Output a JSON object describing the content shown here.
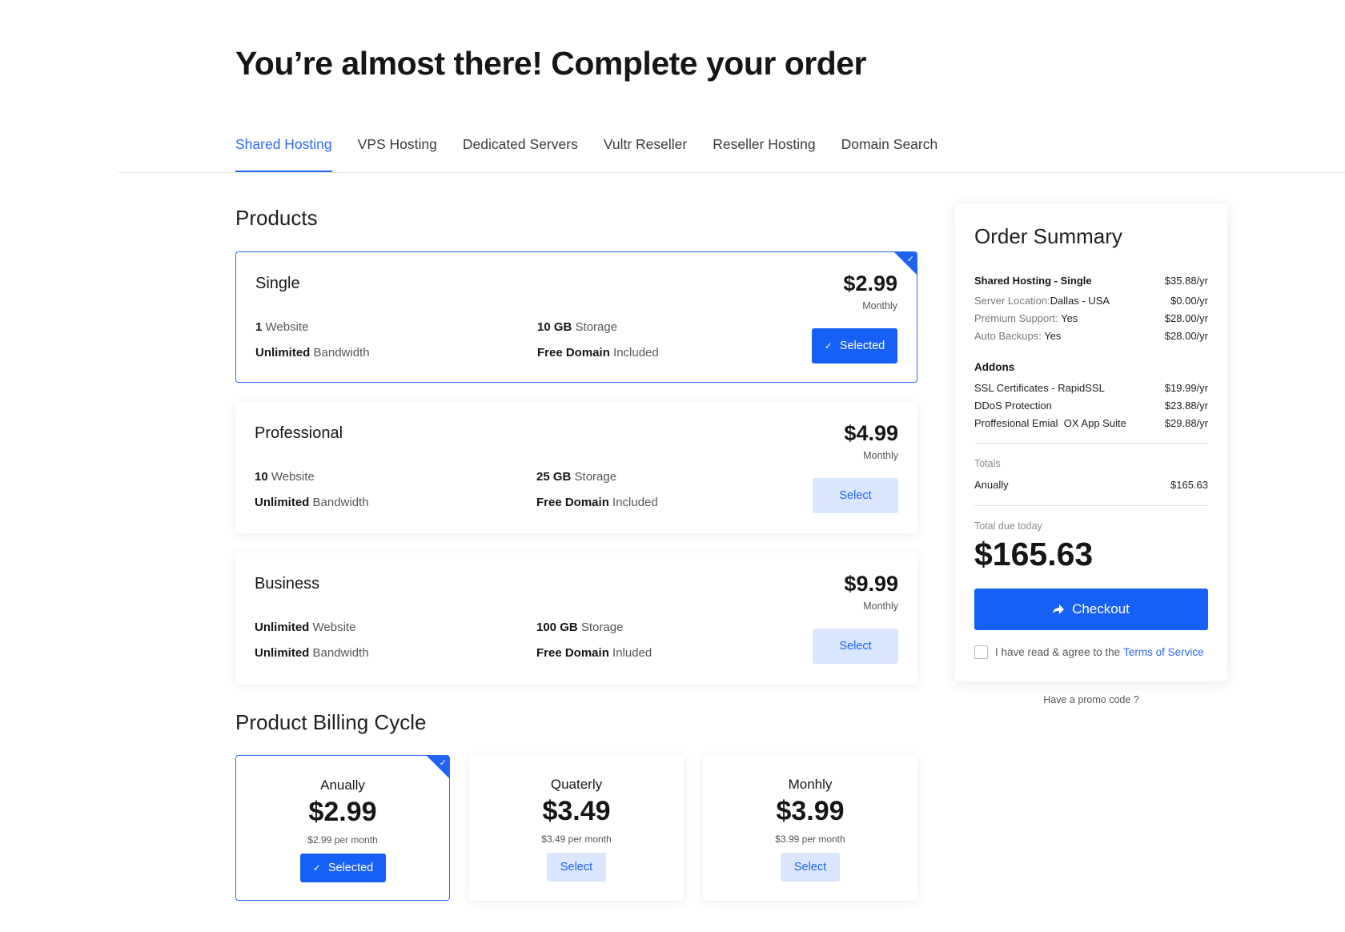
{
  "header": {
    "title": "You’re almost there! Complete your order"
  },
  "tabs": [
    {
      "label": "Shared Hosting",
      "active": true
    },
    {
      "label": "VPS Hosting",
      "active": false
    },
    {
      "label": "Dedicated Servers",
      "active": false
    },
    {
      "label": "Vultr Reseller",
      "active": false
    },
    {
      "label": "Reseller Hosting",
      "active": false
    },
    {
      "label": "Domain Search",
      "active": false
    }
  ],
  "products": {
    "title": "Products",
    "items": [
      {
        "name": "Single",
        "price": "$2.99",
        "period": "Monthly",
        "features": [
          {
            "bold": "1",
            "text": " Website"
          },
          {
            "bold": "10 GB",
            "text": " Storage"
          },
          {
            "bold": "Unlimited",
            "text": " Bandwidth"
          },
          {
            "bold": "Free Domain",
            "text": " Included"
          }
        ],
        "button": "Selected",
        "selected": true
      },
      {
        "name": "Professional",
        "price": "$4.99",
        "period": "Monthly",
        "features": [
          {
            "bold": "10",
            "text": " Website"
          },
          {
            "bold": "25 GB",
            "text": " Storage"
          },
          {
            "bold": "Unlimited",
            "text": " Bandwidth"
          },
          {
            "bold": "Free Domain",
            "text": " Included"
          }
        ],
        "button": "Select",
        "selected": false
      },
      {
        "name": "Business",
        "price": "$9.99",
        "period": "Monthly",
        "features": [
          {
            "bold": "Unlimited",
            "text": " Website"
          },
          {
            "bold": "100 GB",
            "text": " Storage"
          },
          {
            "bold": "Unlimited",
            "text": " Bandwidth"
          },
          {
            "bold": "Free Domain",
            "text": " Inluded"
          }
        ],
        "button": "Select",
        "selected": false
      }
    ]
  },
  "billing": {
    "title": "Product Billing Cycle",
    "items": [
      {
        "name": "Anually",
        "price": "$2.99",
        "per": "$2.99 per month",
        "button": "Selected",
        "selected": true
      },
      {
        "name": "Quaterly",
        "price": "$3.49",
        "per": "$3.49 per month",
        "button": "Select",
        "selected": false
      },
      {
        "name": "Monhly",
        "price": "$3.99",
        "per": "$3.99 per month",
        "button": "Select",
        "selected": false
      }
    ]
  },
  "summary": {
    "title": "Order Summary",
    "main_item": {
      "label": "Shared Hosting - Single",
      "value": "$35.88/yr"
    },
    "details": [
      {
        "label": "Server Location:",
        "detail": "Dallas - USA",
        "value": "$0.00/yr"
      },
      {
        "label": "Premium Support:",
        "detail": " Yes",
        "value": "$28.00/yr"
      },
      {
        "label": "Auto Backups:",
        "detail": " Yes",
        "value": "$28.00/yr"
      }
    ],
    "addons_title": "Addons",
    "addons": [
      {
        "label": "SSL Certificates - RapidSSL",
        "value": "$19.99/yr"
      },
      {
        "label": "DDoS Protection",
        "value": "$23.88/yr"
      },
      {
        "label": "Proffesional Emial  OX App Suite",
        "value": "$29.88/yr"
      }
    ],
    "totals_label": "Totals",
    "annually_label": "Anually",
    "annually_value": "$165.63",
    "due_label": "Total due today",
    "due_value": "$165.63",
    "checkout_label": "Checkout",
    "agree_text": "I have read & agree to the",
    "tos_link": "Terms of Service",
    "promo": "Have a promo code ?"
  },
  "colors": {
    "accent": "#1660f5",
    "accent_light": "#dae6fd",
    "link": "#2b6bf0"
  },
  "icons": {
    "check": "check-icon",
    "checkout": "arrow-forward-icon"
  }
}
